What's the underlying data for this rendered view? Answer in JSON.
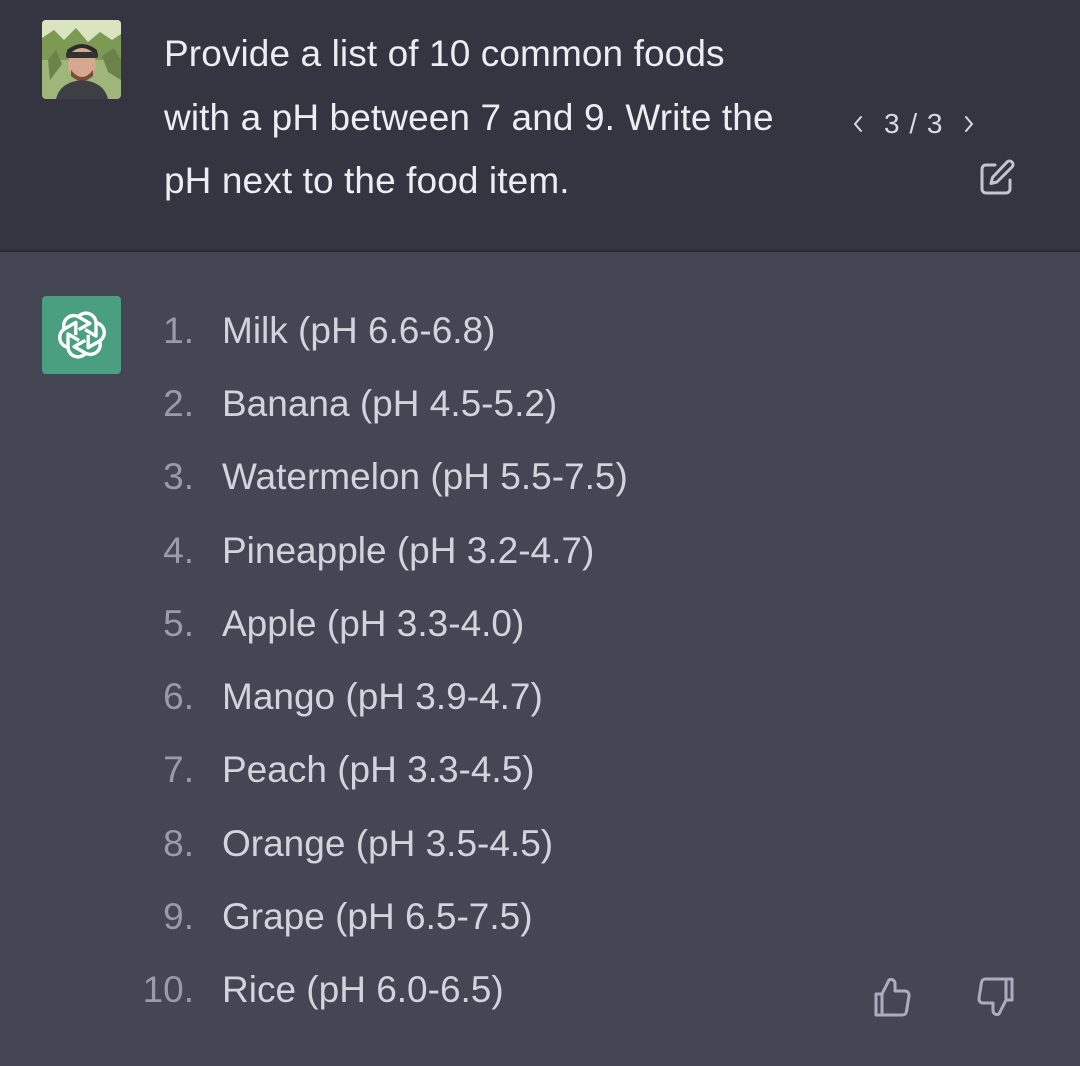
{
  "user_message": {
    "lines": [
      "Provide a list of 10 common foods",
      "with a pH between 7 and 9. Write the",
      "pH next to the food item."
    ],
    "pager": "3 / 3",
    "avatar_icon": "user-avatar-photo",
    "edit_icon": "edit-icon",
    "prev_icon": "chevron-left-icon",
    "next_icon": "chevron-right-icon"
  },
  "assistant_message": {
    "logo_icon": "openai-logo-icon",
    "logo_color": "#4a9f80",
    "items": [
      {
        "num": "1.",
        "text": "Milk (pH 6.6-6.8)"
      },
      {
        "num": "2.",
        "text": "Banana (pH 4.5-5.2)"
      },
      {
        "num": "3.",
        "text": "Watermelon (pH 5.5-7.5)"
      },
      {
        "num": "4.",
        "text": "Pineapple (pH 3.2-4.7)"
      },
      {
        "num": "5.",
        "text": "Apple (pH 3.3-4.0)"
      },
      {
        "num": "6.",
        "text": "Mango (pH 3.9-4.7)"
      },
      {
        "num": "7.",
        "text": "Peach (pH 3.3-4.5)"
      },
      {
        "num": "8.",
        "text": "Orange (pH 3.5-4.5)"
      },
      {
        "num": "9.",
        "text": "Grape (pH 6.5-7.5)"
      },
      {
        "num": "10.",
        "text": "Rice (pH 6.0-6.5)"
      }
    ],
    "thumbs_up_icon": "thumbs-up-icon",
    "thumbs_down_icon": "thumbs-down-icon"
  },
  "colors": {
    "user_bg": "#343541",
    "assistant_bg": "#444654",
    "text": "#ececf1"
  }
}
